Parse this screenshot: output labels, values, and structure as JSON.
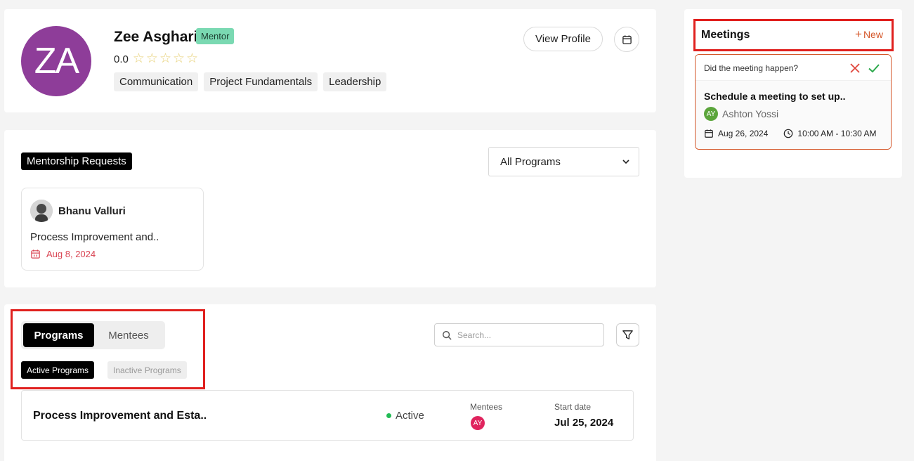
{
  "profile": {
    "initials": "ZA",
    "name": "Zee Asghari",
    "role_badge": "Mentor",
    "rating": "0.0",
    "skills": [
      "Communication",
      "Project Fundamentals",
      "Leadership"
    ],
    "view_profile_label": "View Profile",
    "avatar_color": "#8e3d99",
    "badge_color": "#7ad9b2"
  },
  "requests": {
    "title": "Mentorship Requests",
    "program_filter": "All Programs",
    "items": [
      {
        "name": "Bhanu Valluri",
        "program": "Process Improvement and..",
        "date": "Aug 8, 2024"
      }
    ]
  },
  "programs_section": {
    "tabs": [
      "Programs",
      "Mentees"
    ],
    "sub_tabs": [
      "Active Programs",
      "Inactive Programs"
    ],
    "search_placeholder": "Search...",
    "rows": [
      {
        "name": "Process Improvement and Esta..",
        "status": "Active",
        "mentees_label": "Mentees",
        "mentee_initials": "AY",
        "start_label": "Start date",
        "start_date": "Jul 25, 2024"
      }
    ]
  },
  "meetings": {
    "title": "Meetings",
    "new_label": "New",
    "items": [
      {
        "question": "Did the meeting happen?",
        "subject": "Schedule a meeting to set up..",
        "person_initials": "AY",
        "person": "Ashton Yossi",
        "date": "Aug 26, 2024",
        "time": "10:00 AM - 10:30 AM"
      }
    ],
    "accent_color": "#d4572a"
  }
}
